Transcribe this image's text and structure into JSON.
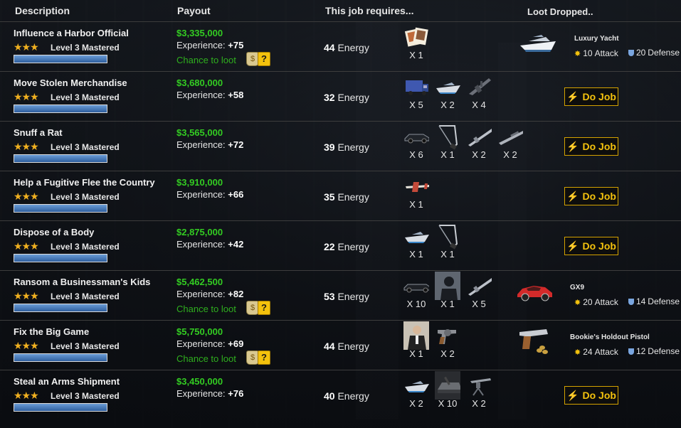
{
  "header": {
    "description": "Description",
    "payout": "Payout",
    "requires": "This job requires...",
    "loot": "Loot Dropped.."
  },
  "labels": {
    "experience": "Experience:",
    "energy": "Energy",
    "mastered": "Level 3 Mastered",
    "chance": "Chance to loot",
    "do_job": "Do Job",
    "attack": "Attack",
    "defense": "Defense"
  },
  "jobs": [
    {
      "title": "Influence a Harbor Official",
      "money": "$3,335,000",
      "exp": "+75",
      "energy": "44",
      "mastery_fraction": 1.0,
      "requires": [
        {
          "icon": "photos-icon",
          "qty": "X 1"
        }
      ],
      "loot": {
        "name": "Luxury Yacht",
        "attack": "10",
        "defense": "20",
        "icon": "yacht-icon"
      },
      "chance": true
    },
    {
      "title": "Move Stolen Merchandise",
      "money": "$3,680,000",
      "exp": "+58",
      "energy": "32",
      "mastery_fraction": 1.0,
      "requires": [
        {
          "icon": "truck-icon",
          "qty": "X 5"
        },
        {
          "icon": "speedboat-icon",
          "qty": "X 2"
        },
        {
          "icon": "machine-gun-icon",
          "qty": "X 4"
        }
      ],
      "loot": null,
      "chance": false
    },
    {
      "title": "Snuff a Rat",
      "money": "$3,565,000",
      "exp": "+72",
      "energy": "39",
      "mastery_fraction": 1.0,
      "requires": [
        {
          "icon": "sedan-icon",
          "qty": "X 6"
        },
        {
          "icon": "hacksaw-icon",
          "qty": "X 1"
        },
        {
          "icon": "rifle-icon",
          "qty": "X 2"
        },
        {
          "icon": "sniper-rifle-icon",
          "qty": "X 2"
        }
      ],
      "loot": null,
      "chance": false
    },
    {
      "title": "Help a Fugitive Flee the Country",
      "money": "$3,910,000",
      "exp": "+66",
      "energy": "35",
      "mastery_fraction": 1.0,
      "requires": [
        {
          "icon": "airplane-icon",
          "qty": "X 1"
        }
      ],
      "loot": null,
      "chance": false
    },
    {
      "title": "Dispose of a Body",
      "money": "$2,875,000",
      "exp": "+42",
      "energy": "22",
      "mastery_fraction": 1.0,
      "requires": [
        {
          "icon": "speedboat-icon",
          "qty": "X 1"
        },
        {
          "icon": "hacksaw-icon",
          "qty": "X 1"
        }
      ],
      "loot": null,
      "chance": false
    },
    {
      "title": "Ransom a Businessman's Kids",
      "money": "$5,462,500",
      "exp": "+82",
      "energy": "53",
      "mastery_fraction": 1.0,
      "requires": [
        {
          "icon": "limousine-icon",
          "qty": "X 10"
        },
        {
          "icon": "informant-icon",
          "qty": "X 1"
        },
        {
          "icon": "rifle-icon",
          "qty": "X 5"
        }
      ],
      "loot": {
        "name": "GX9",
        "attack": "20",
        "defense": "14",
        "icon": "sports-car-icon"
      },
      "chance": true
    },
    {
      "title": "Fix the Big Game",
      "money": "$5,750,000",
      "exp": "+69",
      "energy": "44",
      "mastery_fraction": 1.0,
      "requires": [
        {
          "icon": "bodyguard-icon",
          "qty": "X 1"
        },
        {
          "icon": "revolver-icon",
          "qty": "X 2"
        }
      ],
      "loot": {
        "name": "Bookie's Holdout Pistol",
        "attack": "24",
        "defense": "12",
        "icon": "pistol-icon"
      },
      "chance": true
    },
    {
      "title": "Steal an Arms Shipment",
      "money": "$3,450,000",
      "exp": "+76",
      "energy": "40",
      "mastery_fraction": 1.0,
      "requires": [
        {
          "icon": "speedboat-icon",
          "qty": "X 2"
        },
        {
          "icon": "armored-vehicle-icon",
          "qty": "X 10"
        },
        {
          "icon": "mounted-gun-icon",
          "qty": "X 2"
        }
      ],
      "loot": null,
      "chance": false
    }
  ]
}
